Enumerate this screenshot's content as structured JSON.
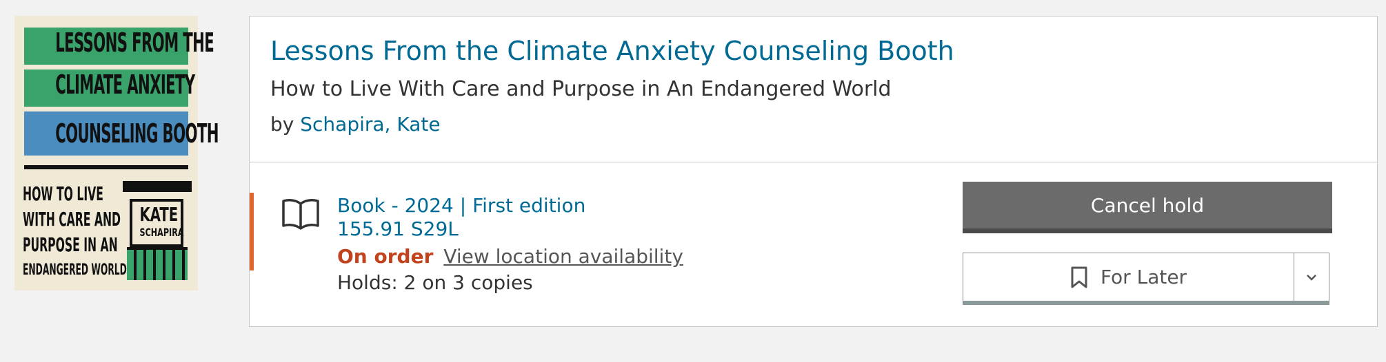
{
  "cover": {
    "title_lines": [
      "LESSONS FROM THE",
      "CLIMATE ANXIETY",
      "COUNSELING BOOTH"
    ],
    "subtitle_lines": [
      "HOW TO LIVE",
      "WITH CARE AND",
      "PURPOSE IN AN",
      "ENDANGERED WORLD"
    ],
    "author_first": "KATE",
    "author_last": "SCHAPIRA"
  },
  "record": {
    "title": "Lessons From the Climate Anxiety Counseling Booth",
    "subtitle": "How to Live With Care and Purpose in An Endangered World",
    "by_label": "by",
    "author": "Schapira, Kate"
  },
  "availability": {
    "format_icon": "book-open-icon",
    "format": "Book - 2024 | First edition",
    "call_number": "155.91 S29L",
    "status": "On order",
    "location_link": "View location availability",
    "holds": "Holds: 2 on 3 copies"
  },
  "actions": {
    "cancel_hold": "Cancel hold",
    "for_later": "For Later",
    "bookmark_icon": "bookmark-icon",
    "dropdown_icon": "chevron-down-icon"
  },
  "colors": {
    "link": "#006a94",
    "status_on_order": "#c1421d",
    "accent_bar": "#e0662e",
    "cancel_button": "#6b6b6b"
  }
}
